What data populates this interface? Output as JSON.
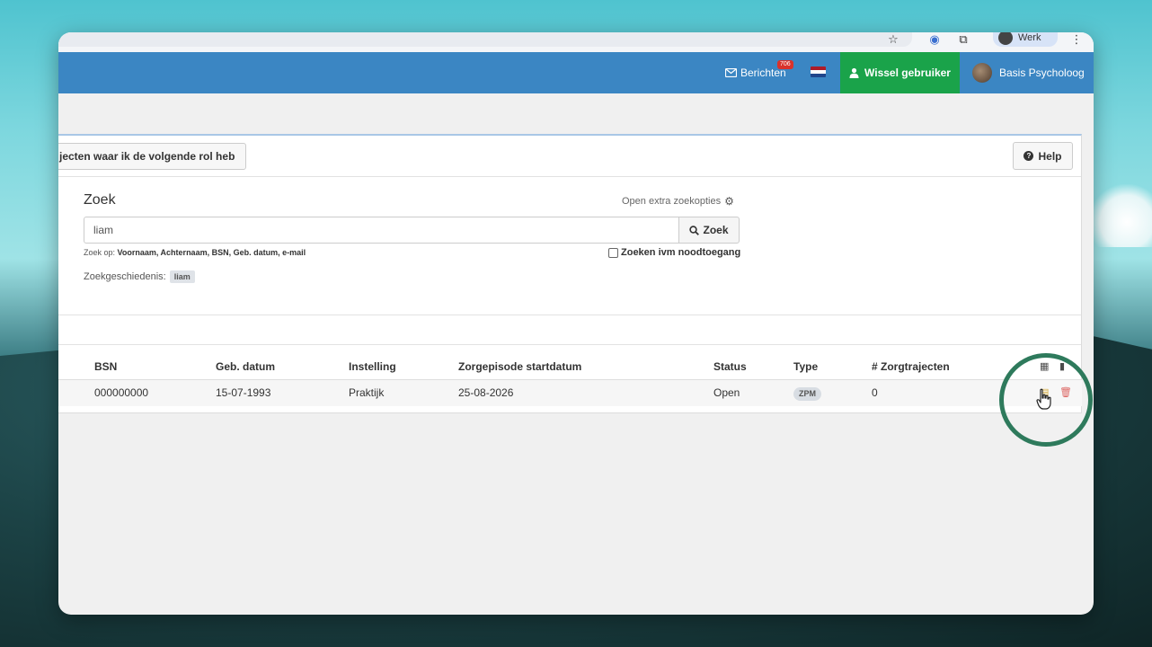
{
  "browser": {
    "profile_label": "Werk",
    "icons": [
      "star-icon",
      "extension-icon",
      "puzzle-icon",
      "more-icon"
    ]
  },
  "topnav": {
    "messages_label": "Berichten",
    "messages_count": "706",
    "language_flag": "nl",
    "switch_user_label": "Wissel gebruiker",
    "user_label": "Basis Psycholoog"
  },
  "panel": {
    "role_button_label": "jecten waar ik de volgende rol heb",
    "help_label": "Help",
    "search": {
      "title": "Zoek",
      "extra_options_label": "Open extra zoekopties",
      "value": "liam",
      "button_label": "Zoek",
      "hint_prefix": "Zoek op:",
      "hint_fields": "Voornaam, Achternaam, BSN, Geb. datum, e-mail",
      "emergency_label": "Zoeken ivm noodtoegang",
      "history_label": "Zoekgeschiedenis:",
      "history_items": [
        "liam"
      ]
    }
  },
  "table": {
    "columns": [
      "BSN",
      "Geb. datum",
      "Instelling",
      "Zorgepisode startdatum",
      "Status",
      "Type",
      "# Zorgtrajecten"
    ],
    "rows": [
      {
        "bsn": "000000000",
        "birth_date": "15-07-1993",
        "institution": "Praktijk",
        "episode_start": "25-08-2026",
        "status": "Open",
        "type": "ZPM",
        "care_paths": "0"
      }
    ]
  },
  "colors": {
    "nav_blue": "#3b86c3",
    "switch_green": "#1aa34a",
    "highlight_ring": "#2e7a5c",
    "delete_red": "#d9534f"
  }
}
